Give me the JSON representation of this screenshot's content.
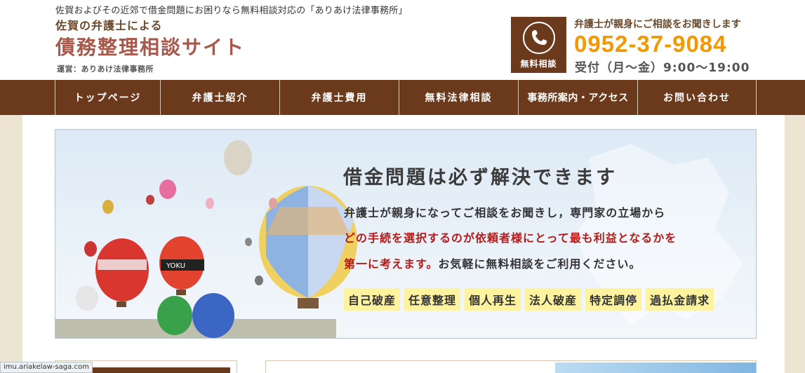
{
  "header": {
    "tagline": "佐賀およびその近郊で借金問題にお困りなら無料相談対応の「ありあけ法律事務所」",
    "subtitle": "佐賀の弁護士による",
    "site_title": "債務整理相談サイト",
    "operator": "運営：ありあけ法律事務所",
    "free_consult_label": "無料相談",
    "contact_lead": "弁護士が親身にご相談をお聞きします",
    "phone": "0952-37-9084",
    "hours": "受付（月〜金）9:00〜19:00",
    "phone_icon": "phone-icon"
  },
  "nav": {
    "items": [
      {
        "label": "トップページ"
      },
      {
        "label": "弁護士紹介"
      },
      {
        "label": "弁護士費用"
      },
      {
        "label": "無料法律相談"
      },
      {
        "label": "事務所案内・アクセス"
      },
      {
        "label": "お問い合わせ"
      }
    ]
  },
  "hero": {
    "title": "借金問題は必ず解決できます",
    "line1": "弁護士が親身になってご相談をお聞きし，専門家の立場から",
    "line2": "どの手続を選択するのが依頼者様にとって最も利益となるかを",
    "line3_red": "第一に考えます。",
    "line3_rest": "お気軽に無料相談をご利用ください。",
    "tags": [
      "自己破産",
      "任意整理",
      "個人再生",
      "法人破産",
      "特定調停",
      "過払金請求"
    ],
    "balloon_text": "YOKU"
  },
  "status_bar": {
    "url": "imu.ariakelaw-saga.com"
  },
  "colors": {
    "brand_brown": "#6b3a1c",
    "title_red": "#a8584a",
    "phone_orange": "#f39800",
    "emphasis_red": "#b31b1b",
    "tag_yellow": "#fff3a0"
  }
}
